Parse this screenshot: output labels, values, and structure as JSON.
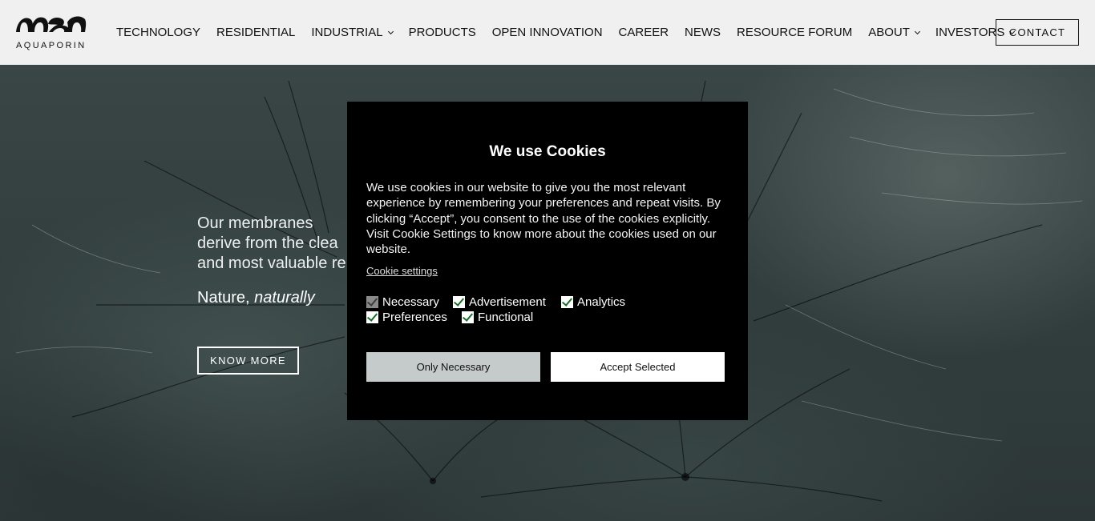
{
  "brand": {
    "logo_text": "AQUAPORIN"
  },
  "nav": {
    "items": [
      {
        "label": "TECHNOLOGY",
        "dropdown": false
      },
      {
        "label": "RESIDENTIAL",
        "dropdown": false
      },
      {
        "label": "INDUSTRIAL",
        "dropdown": true
      },
      {
        "label": "PRODUCTS",
        "dropdown": false
      },
      {
        "label": "OPEN INNOVATION",
        "dropdown": false
      },
      {
        "label": "CAREER",
        "dropdown": false
      },
      {
        "label": "NEWS",
        "dropdown": false
      },
      {
        "label": "RESOURCE FORUM",
        "dropdown": false
      },
      {
        "label": "ABOUT",
        "dropdown": true
      },
      {
        "label": "INVESTORS",
        "dropdown": true
      }
    ],
    "contact_label": "CONTACT"
  },
  "hero": {
    "line1": "Our membranes",
    "line2": "derive from the clea",
    "line3": "and most valuable re",
    "tagline_a": "Nature,",
    "tagline_b": "naturally",
    "cta_label": "KNOW MORE"
  },
  "cookie_modal": {
    "title": "We use Cookies",
    "body": "We use cookies in our website to give you the most relevant experience by remembering your preferences and repeat visits. By clicking “Accept”, you consent to the use of the cookies explicitly. Visit Cookie Settings to know more about the cookies used on our website.",
    "settings_link": "Cookie settings",
    "options": [
      {
        "label": "Necessary",
        "checked": true,
        "disabled": true
      },
      {
        "label": "Advertisement",
        "checked": true,
        "disabled": false
      },
      {
        "label": "Analytics",
        "checked": true,
        "disabled": false
      },
      {
        "label": "Preferences",
        "checked": true,
        "disabled": false
      },
      {
        "label": "Functional",
        "checked": true,
        "disabled": false
      }
    ],
    "only_necessary_label": "Only Necessary",
    "accept_selected_label": "Accept Selected"
  },
  "colors": {
    "header_bg": "#f0f0f0",
    "modal_bg": "#000000",
    "secondary_button": "#c4cbca",
    "check_color": "#1b6e2b"
  }
}
